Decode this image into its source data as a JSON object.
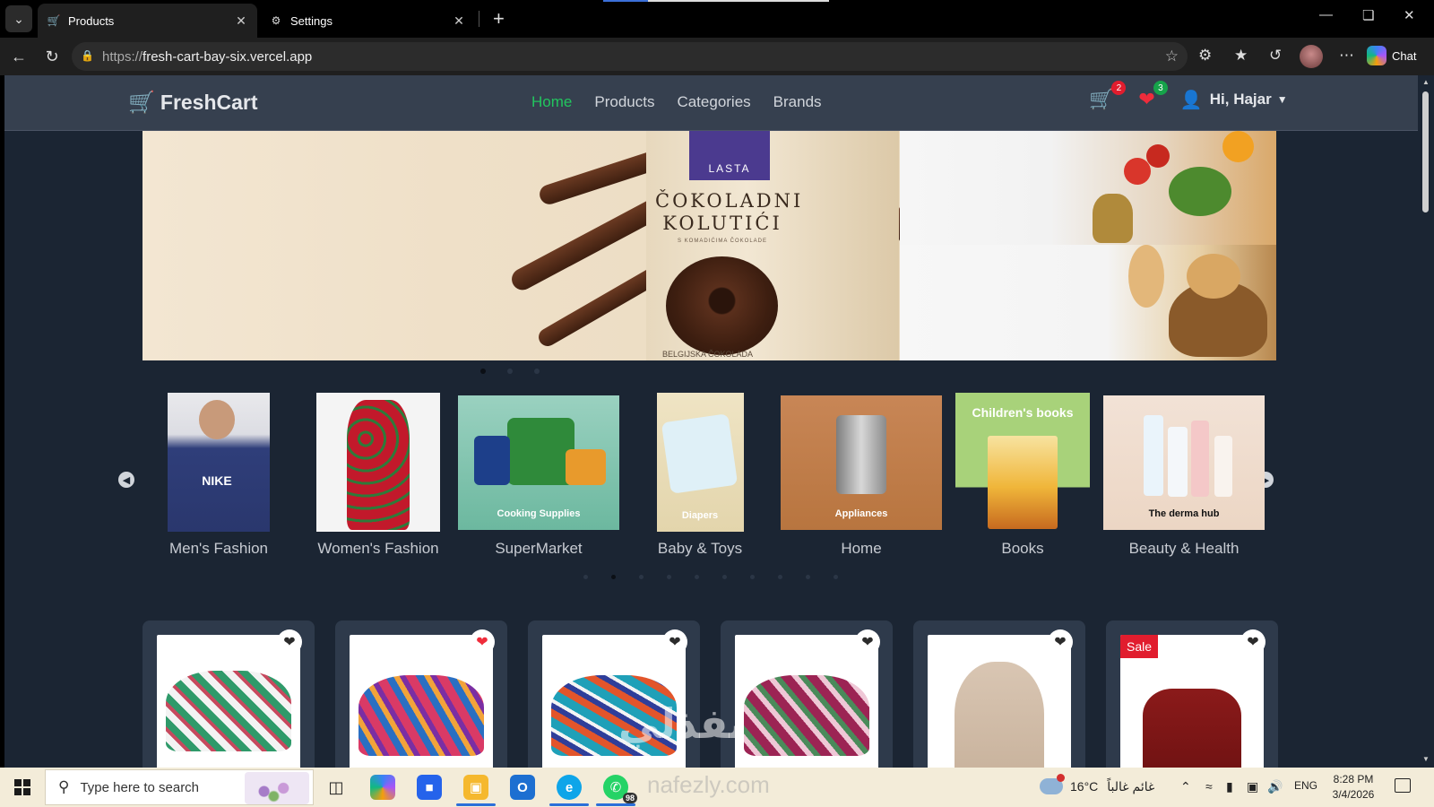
{
  "browser": {
    "tabs": [
      {
        "title": "Products",
        "active": true
      },
      {
        "title": "Settings",
        "active": false
      }
    ],
    "url_host": "fresh-cart-bay-six.vercel.app",
    "url_scheme": "https://",
    "chat_label": "Chat"
  },
  "site": {
    "brand": "FreshCart",
    "menu": [
      "Home",
      "Products",
      "Categories",
      "Brands"
    ],
    "active_menu": "Home",
    "cart_count": "2",
    "wishlist_count": "3",
    "greeting": "Hi, Hajar"
  },
  "hero": {
    "package_brand": "LASTA",
    "package_title_line1": "ČOKOLADNI",
    "package_title_line2": "KOLUTIĆI",
    "package_sub": "S KOMADIĆIMA ČOKOLADE",
    "package_bottom": "BELGIJSKA ČOKOLADA",
    "slides": 3,
    "active_slide": 0
  },
  "categories": [
    {
      "name": "Men's Fashion",
      "caption": ""
    },
    {
      "name": "Women's Fashion",
      "caption": ""
    },
    {
      "name": "SuperMarket",
      "caption": "Cooking Supplies"
    },
    {
      "name": "Baby & Toys",
      "caption": "Diapers"
    },
    {
      "name": "Home",
      "caption": "Appliances"
    },
    {
      "name": "Books",
      "caption": "Children's books"
    },
    {
      "name": "Beauty & Health",
      "caption": "The derma hub"
    }
  ],
  "category_dots": 10,
  "category_active_dot": 1,
  "products": [
    {
      "liked": false,
      "sale": ""
    },
    {
      "liked": true,
      "sale": ""
    },
    {
      "liked": false,
      "sale": ""
    },
    {
      "liked": false,
      "sale": ""
    },
    {
      "liked": false,
      "sale": ""
    },
    {
      "liked": false,
      "sale": "Sale"
    }
  ],
  "taskbar": {
    "search_placeholder": "Type here to search",
    "whatsapp_badge": "98",
    "temperature": "16°C",
    "weather_text": "غائم غالباً",
    "language": "ENG",
    "time": "8:28 PM",
    "date": "3/4/2026"
  },
  "watermark": "نفذلي",
  "watermark_sub": "nafezly.com",
  "colors": {
    "accent_green": "#22c55e",
    "navbar": "#36404f",
    "page_bg": "#1b2533",
    "card_bg": "#2e3a4b",
    "badge_red": "#e11d2e"
  }
}
